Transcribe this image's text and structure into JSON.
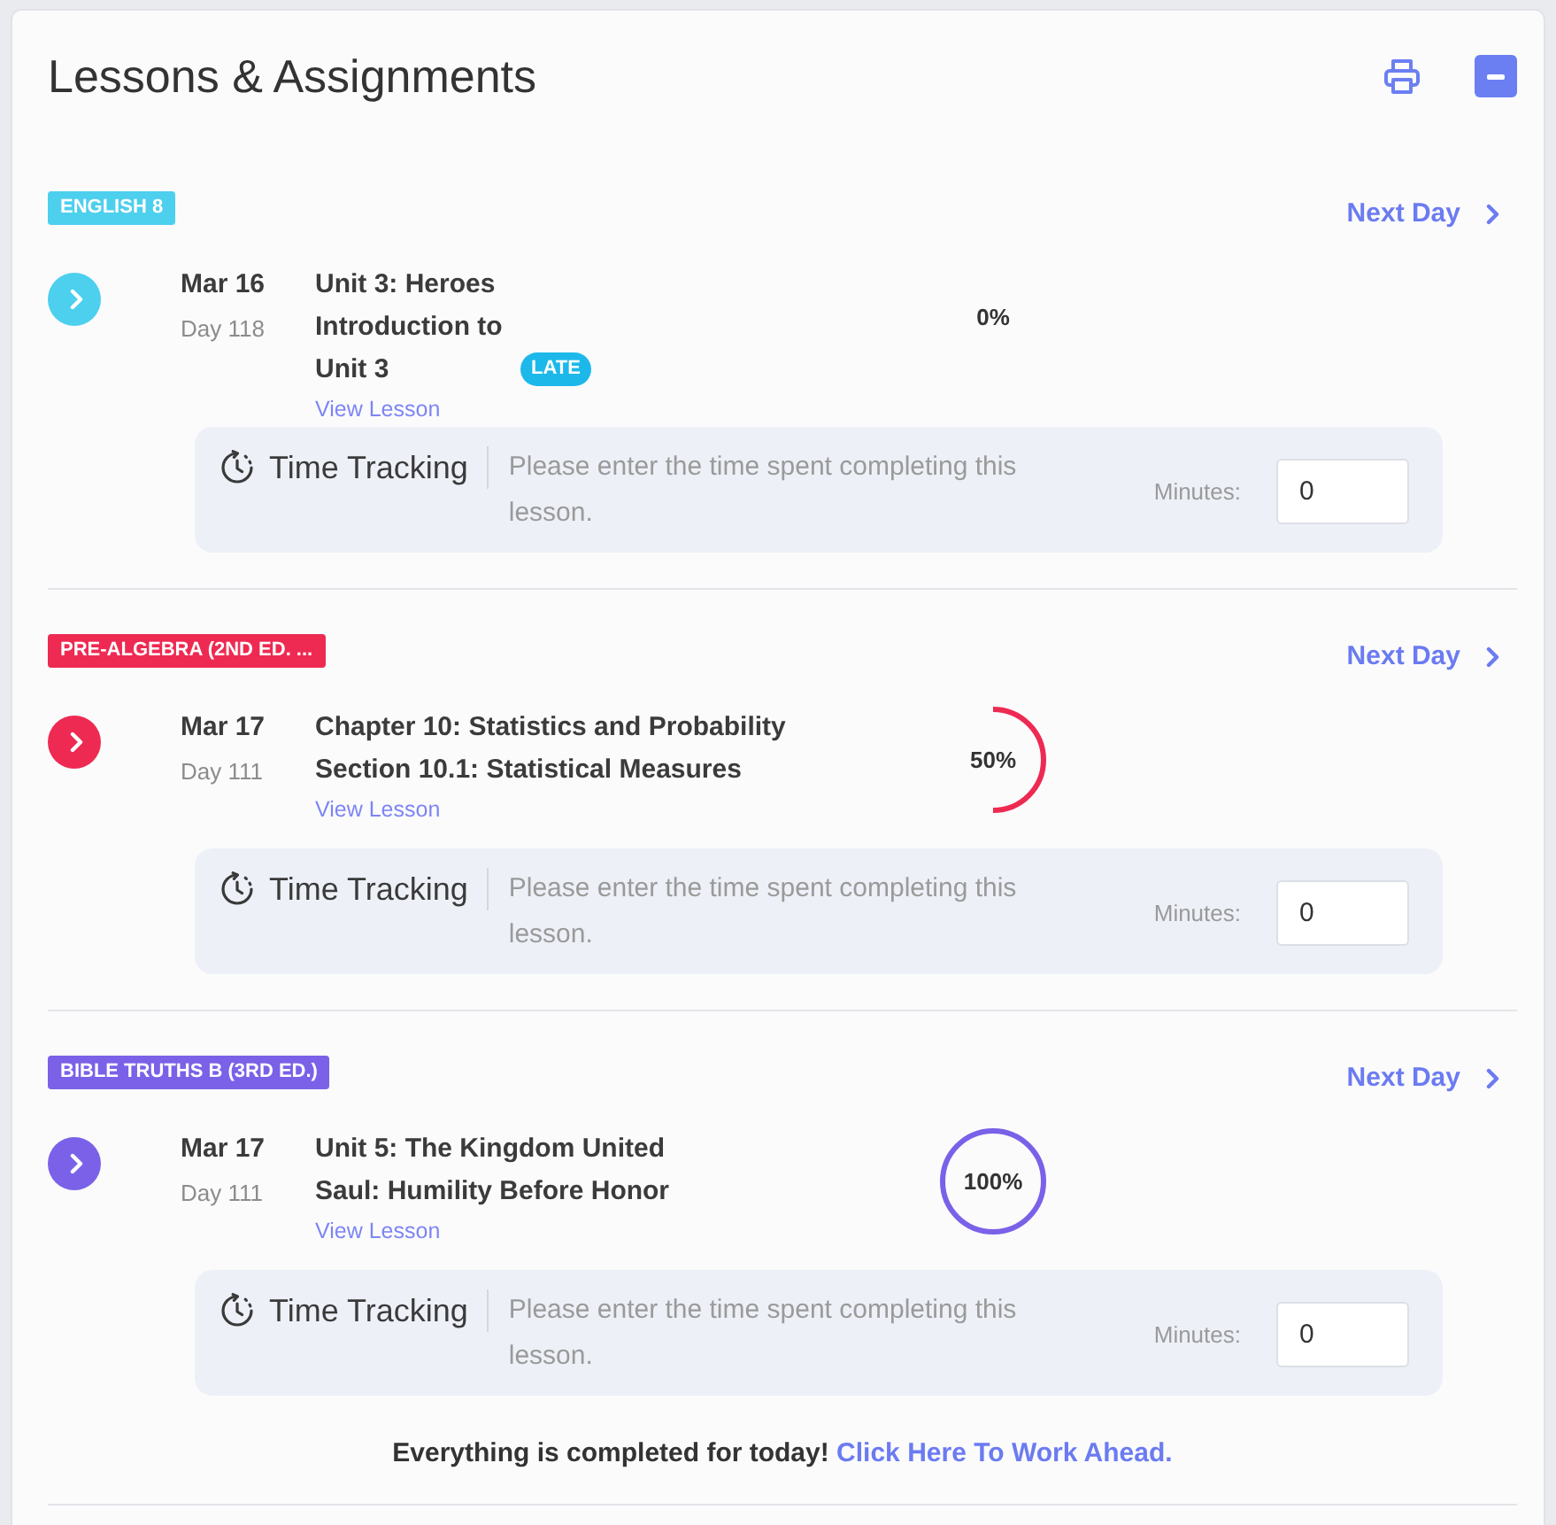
{
  "header": {
    "title": "Lessons & Assignments"
  },
  "subjects": [
    {
      "name": "ENGLISH 8",
      "color": "#4dcfee",
      "next_day": "Next Day",
      "lesson": {
        "date": "Mar 16",
        "day": "Day 118",
        "unit": "Unit 3: Heroes",
        "title": "Introduction to Unit 3",
        "late_badge": "LATE",
        "link": "View Lesson",
        "progress": "0%"
      },
      "time_tracking": {
        "title": "Time Tracking",
        "description": "Please enter the time spent completing this lesson.",
        "minutes_label": "Minutes:",
        "minutes": "0"
      }
    },
    {
      "name": "PRE-ALGEBRA (2ND ED. ...",
      "color": "#ee2a52",
      "next_day": "Next Day",
      "lesson": {
        "date": "Mar 17",
        "day": "Day 111",
        "unit": "Chapter 10: Statistics and Probability",
        "title": "Section 10.1: Statistical Measures",
        "link": "View Lesson",
        "level": 0.5,
        "progress": "50%"
      },
      "time_tracking": {
        "title": "Time Tracking",
        "description": "Please enter the time spent completing this lesson.",
        "minutes_label": "Minutes:",
        "minutes": "0"
      }
    },
    {
      "name": "BIBLE TRUTHS B (3RD ED.)",
      "color": "#7a61e8",
      "next_day": "Next Day",
      "lesson": {
        "date": "Mar 17",
        "day": "Day 111",
        "unit": "Unit 5: The Kingdom United",
        "title": "Saul: Humility Before Honor",
        "link": "View Lesson",
        "level": 1,
        "progress": "100%"
      },
      "time_tracking": {
        "title": "Time Tracking",
        "description": "Please enter the time spent completing this lesson.",
        "minutes_label": "Minutes:",
        "minutes": "0"
      }
    }
  ],
  "footer": {
    "message": "Everything is completed for today!",
    "link": "Click Here To Work Ahead."
  }
}
